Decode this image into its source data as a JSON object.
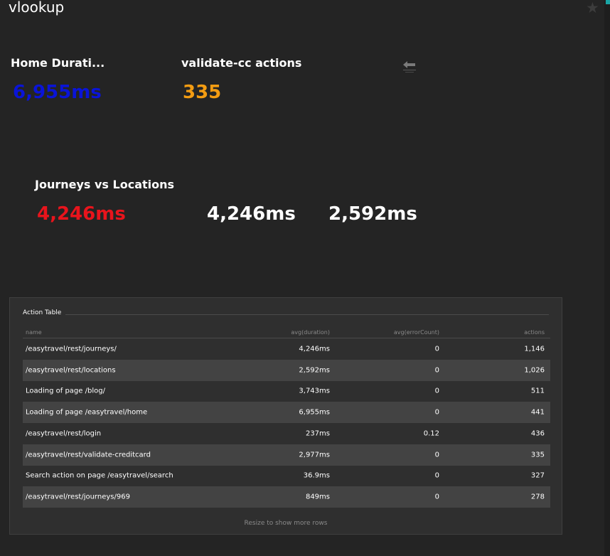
{
  "page": {
    "title": "vlookup"
  },
  "tiles": {
    "home": {
      "label": "Home Durati...",
      "value": "6,955ms",
      "color": "#0a14d8"
    },
    "validate": {
      "label": "validate-cc actions",
      "value": "335",
      "color": "#f39c12"
    },
    "journeys": {
      "label": "Journeys vs Locations",
      "value1": "4,246ms",
      "value1_color": "#e8141c",
      "value2": "4,246ms",
      "value3": "2,592ms"
    }
  },
  "action_table": {
    "title": "Action Table",
    "columns": [
      "name",
      "avg(duration)",
      "avg(errorCount)",
      "actions"
    ],
    "rows": [
      [
        "/easytravel/rest/journeys/",
        "4,246ms",
        "0",
        "1,146"
      ],
      [
        "/easytravel/rest/locations",
        "2,592ms",
        "0",
        "1,026"
      ],
      [
        "Loading of page /blog/",
        "3,743ms",
        "0",
        "511"
      ],
      [
        "Loading of page /easytravel/home",
        "6,955ms",
        "0",
        "441"
      ],
      [
        "/easytravel/rest/login",
        "237ms",
        "0.12",
        "436"
      ],
      [
        "/easytravel/rest/validate-creditcard",
        "2,977ms",
        "0",
        "335"
      ],
      [
        "Search action on page /easytravel/search",
        "36.9ms",
        "0",
        "327"
      ],
      [
        "/easytravel/rest/journeys/969",
        "849ms",
        "0",
        "278"
      ]
    ],
    "footer": "Resize to show more rows"
  },
  "icons": {
    "star": "star-icon",
    "back": "back-arrow-icon"
  }
}
